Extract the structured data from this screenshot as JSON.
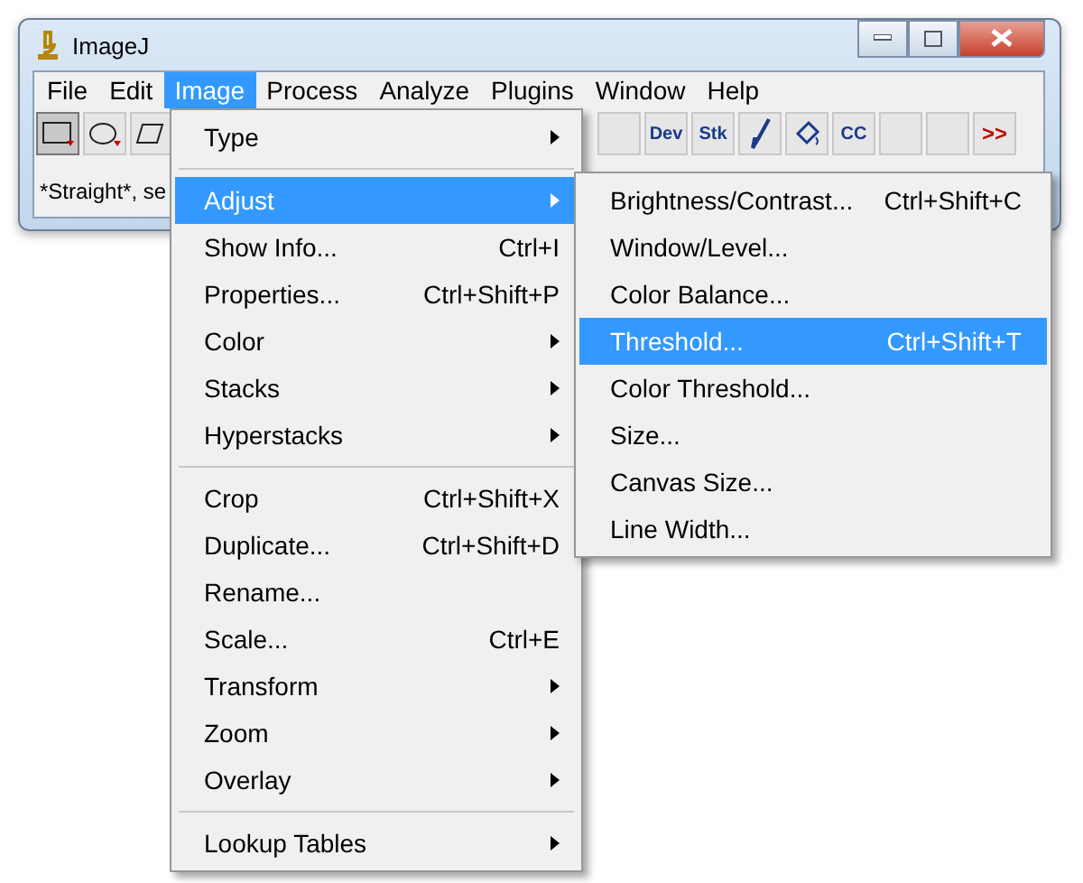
{
  "window": {
    "title": "ImageJ"
  },
  "menubar": [
    {
      "label": "File",
      "selected": false
    },
    {
      "label": "Edit",
      "selected": false
    },
    {
      "label": "Image",
      "selected": true
    },
    {
      "label": "Process",
      "selected": false
    },
    {
      "label": "Analyze",
      "selected": false
    },
    {
      "label": "Plugins",
      "selected": false
    },
    {
      "label": "Window",
      "selected": false
    },
    {
      "label": "Help",
      "selected": false
    }
  ],
  "toolbar_left": [
    {
      "kind": "rectangle",
      "selected": true
    },
    {
      "kind": "oval",
      "selected": false
    },
    {
      "kind": "polygon",
      "selected": false
    }
  ],
  "toolbar_right": [
    {
      "kind": "blank"
    },
    {
      "kind": "text",
      "label": "Dev"
    },
    {
      "kind": "text",
      "label": "Stk"
    },
    {
      "kind": "brush"
    },
    {
      "kind": "bucket"
    },
    {
      "kind": "text",
      "label": "CC"
    },
    {
      "kind": "blank"
    },
    {
      "kind": "blank"
    },
    {
      "kind": "more",
      "label": ">>"
    }
  ],
  "status": "*Straight*, se",
  "image_menu": [
    {
      "label": "Type",
      "submenu": true,
      "selected": false,
      "separator_after": true
    },
    {
      "label": "Adjust",
      "submenu": true,
      "selected": true
    },
    {
      "label": "Show Info...",
      "shortcut": "Ctrl+I",
      "submenu": false,
      "selected": false
    },
    {
      "label": "Properties...",
      "shortcut": "Ctrl+Shift+P",
      "submenu": false,
      "selected": false
    },
    {
      "label": "Color",
      "submenu": true,
      "selected": false
    },
    {
      "label": "Stacks",
      "submenu": true,
      "selected": false
    },
    {
      "label": "Hyperstacks",
      "submenu": true,
      "selected": false,
      "separator_after": true
    },
    {
      "label": "Crop",
      "shortcut": "Ctrl+Shift+X",
      "submenu": false,
      "selected": false
    },
    {
      "label": "Duplicate...",
      "shortcut": "Ctrl+Shift+D",
      "submenu": false,
      "selected": false
    },
    {
      "label": "Rename...",
      "submenu": false,
      "selected": false
    },
    {
      "label": "Scale...",
      "shortcut": "Ctrl+E",
      "submenu": false,
      "selected": false
    },
    {
      "label": "Transform",
      "submenu": true,
      "selected": false
    },
    {
      "label": "Zoom",
      "submenu": true,
      "selected": false
    },
    {
      "label": "Overlay",
      "submenu": true,
      "selected": false,
      "separator_after": true
    },
    {
      "label": "Lookup Tables",
      "submenu": true,
      "selected": false
    }
  ],
  "adjust_menu": [
    {
      "label": "Brightness/Contrast...",
      "shortcut": "Ctrl+Shift+C",
      "selected": false
    },
    {
      "label": "Window/Level...",
      "selected": false
    },
    {
      "label": "Color Balance...",
      "selected": false
    },
    {
      "label": "Threshold...",
      "shortcut": "Ctrl+Shift+T",
      "selected": true
    },
    {
      "label": "Color Threshold...",
      "selected": false
    },
    {
      "label": "Size...",
      "selected": false
    },
    {
      "label": "Canvas Size...",
      "selected": false
    },
    {
      "label": "Line Width...",
      "selected": false
    }
  ]
}
